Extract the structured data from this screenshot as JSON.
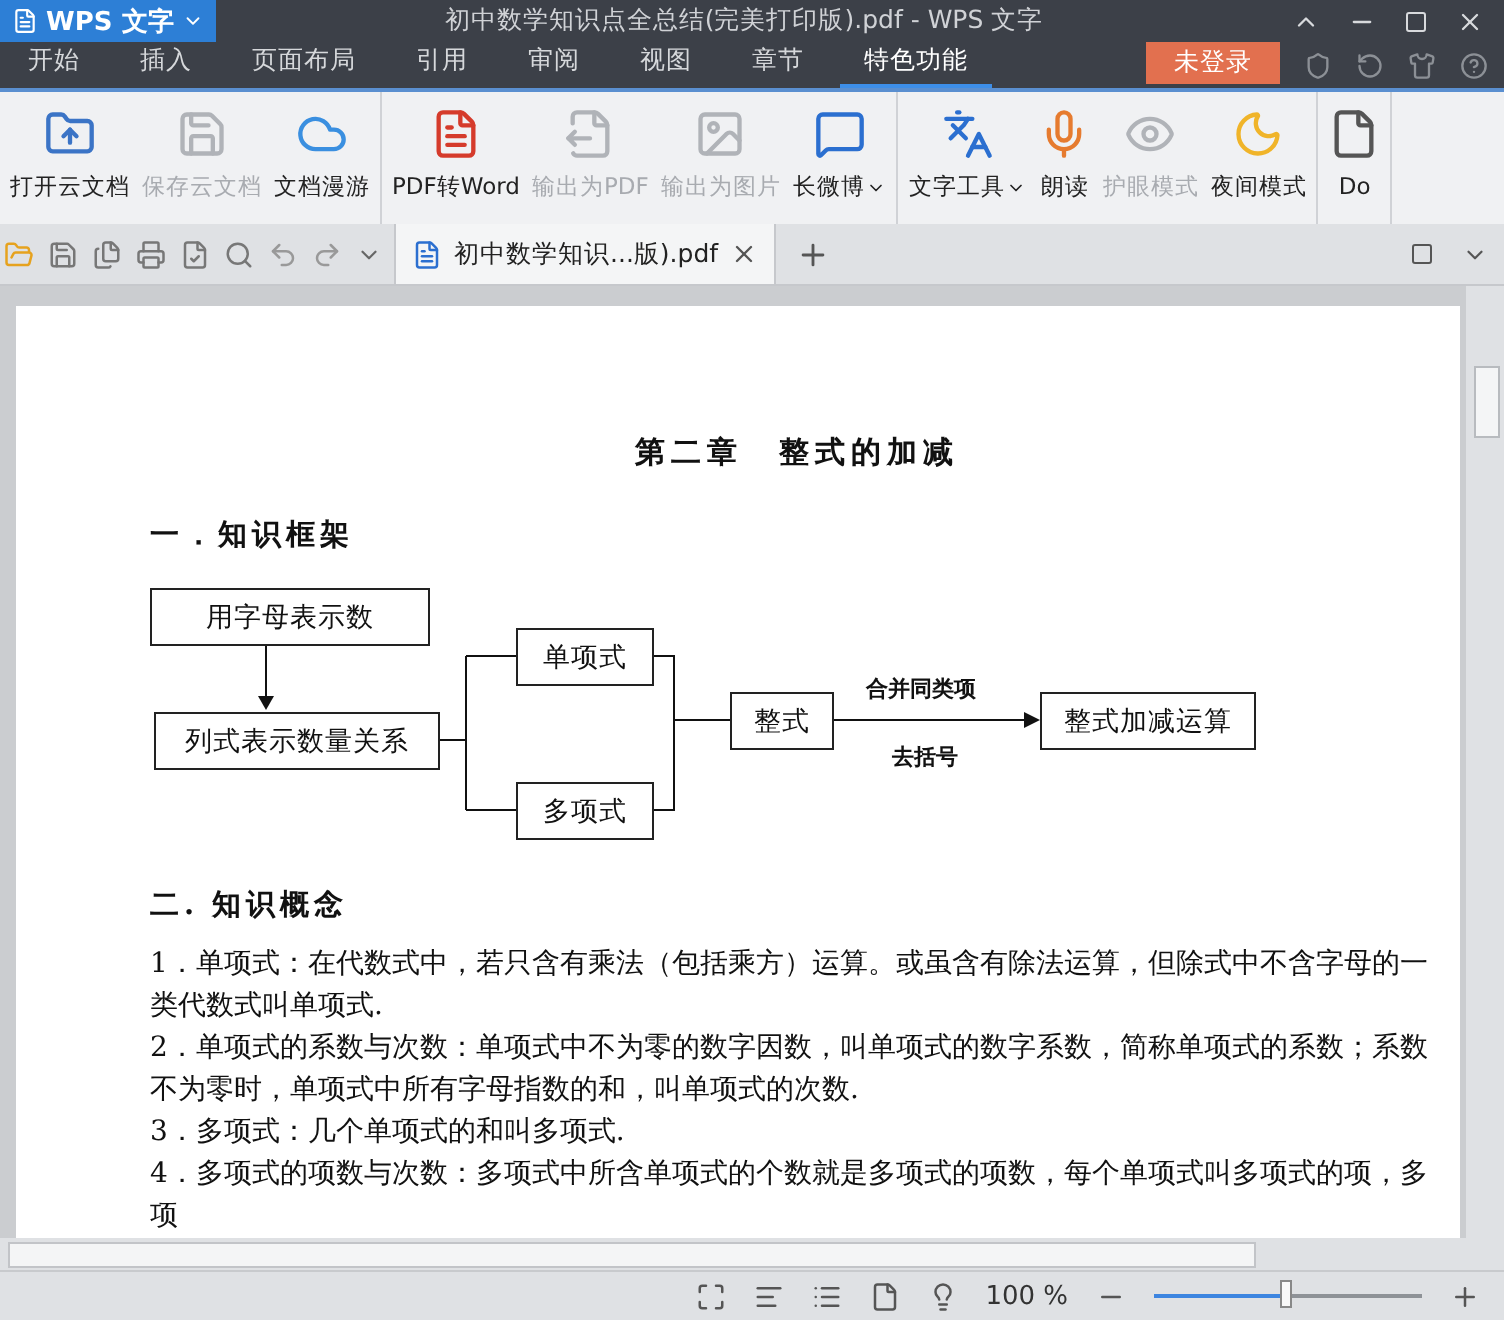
{
  "window": {
    "app_button": "WPS 文字",
    "title": "初中数学知识点全总结(完美打印版).pdf - WPS 文字"
  },
  "menu_tabs": [
    {
      "label": "开始",
      "selected": false
    },
    {
      "label": "插入",
      "selected": false
    },
    {
      "label": "页面布局",
      "selected": false
    },
    {
      "label": "引用",
      "selected": false
    },
    {
      "label": "审阅",
      "selected": false
    },
    {
      "label": "视图",
      "selected": false
    },
    {
      "label": "章节",
      "selected": false
    },
    {
      "label": "特色功能",
      "selected": true
    }
  ],
  "login_button": "未登录",
  "ribbon_groups": [
    {
      "items": [
        {
          "label": "打开云文档",
          "disabled": false,
          "dropdown": false
        },
        {
          "label": "保存云文档",
          "disabled": true,
          "dropdown": false
        },
        {
          "label": "文档漫游",
          "disabled": false,
          "dropdown": false
        }
      ]
    },
    {
      "items": [
        {
          "label": "PDF转Word",
          "disabled": false,
          "dropdown": false
        },
        {
          "label": "输出为PDF",
          "disabled": true,
          "dropdown": false
        },
        {
          "label": "输出为图片",
          "disabled": true,
          "dropdown": false
        },
        {
          "label": "长微博",
          "disabled": false,
          "dropdown": true
        }
      ]
    },
    {
      "items": [
        {
          "label": "文字工具",
          "disabled": false,
          "dropdown": true
        },
        {
          "label": "朗读",
          "disabled": false,
          "dropdown": false
        },
        {
          "label": "护眼模式",
          "disabled": true,
          "dropdown": false
        },
        {
          "label": "夜间模式",
          "disabled": false,
          "dropdown": false
        }
      ]
    },
    {
      "items": [
        {
          "label": "Do",
          "disabled": false,
          "dropdown": false
        }
      ]
    }
  ],
  "document_tab": {
    "label": "初中数学知识...版).pdf"
  },
  "document": {
    "title": "第二章　整式的加减",
    "section_1": "一．知识框架",
    "diagram": {
      "nodes": [
        "用字母表示数",
        "列式表示数量关系",
        "单项式",
        "多项式",
        "整式",
        "整式加减运算"
      ],
      "arrow_labels": [
        "合并同类项",
        "去括号"
      ]
    },
    "section_2": "二. 知识概念",
    "paragraphs": [
      "1．单项式：在代数式中，若只含有乘法（包括乘方）运算。或虽含有除法运算，但除式中不含字母的一类代数式叫单项式.",
      "2．单项式的系数与次数：单项式中不为零的数字因数，叫单项式的数字系数，简称单项式的系数；系数不为零时，单项式中所有字母指数的和，叫单项式的次数.",
      "3．多项式：几个单项式的和叫多项式.",
      "4．多项式的项数与次数：多项式中所含单项式的个数就是多项式的项数，每个单项式叫多项式的项，多项"
    ]
  },
  "status_bar": {
    "zoom": "100 %",
    "zoom_slider": {
      "level": 0.5
    }
  }
}
